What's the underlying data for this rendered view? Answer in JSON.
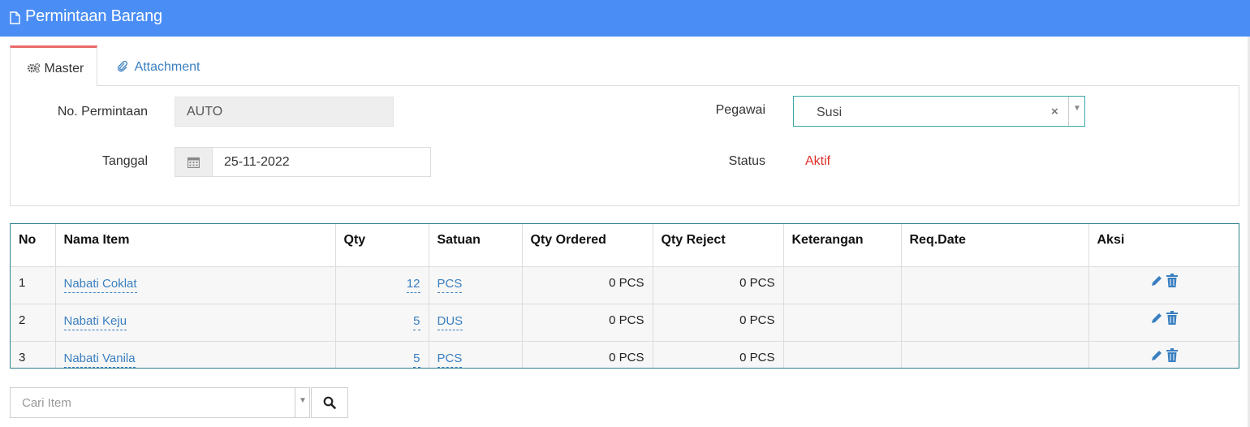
{
  "page": {
    "title": "Permintaan Barang"
  },
  "tabs": [
    {
      "label": "Master",
      "icon": "gears-icon",
      "active": true
    },
    {
      "label": "Attachment",
      "icon": "paperclip-icon",
      "active": false
    }
  ],
  "form": {
    "no_permintaan_label": "No. Permintaan",
    "no_permintaan_value": "AUTO",
    "tanggal_label": "Tanggal",
    "tanggal_value": "25-11-2022",
    "pegawai_label": "Pegawai",
    "pegawai_value": "Susi",
    "status_label": "Status",
    "status_value": "Aktif"
  },
  "table": {
    "columns": [
      "No",
      "Nama Item",
      "Qty",
      "Satuan",
      "Qty Ordered",
      "Qty Reject",
      "Keterangan",
      "Req.Date",
      "Aksi"
    ],
    "rows": [
      {
        "no": "1",
        "nama_item": "Nabati Coklat",
        "qty": "12",
        "satuan": "PCS",
        "qty_ordered": "0 PCS",
        "qty_reject": "0 PCS",
        "keterangan": "",
        "req_date": ""
      },
      {
        "no": "2",
        "nama_item": "Nabati Keju",
        "qty": "5",
        "satuan": "DUS",
        "qty_ordered": "0 PCS",
        "qty_reject": "0 PCS",
        "keterangan": "",
        "req_date": ""
      },
      {
        "no": "3",
        "nama_item": "Nabati Vanila",
        "qty": "5",
        "satuan": "PCS",
        "qty_ordered": "0 PCS",
        "qty_reject": "0 PCS",
        "keterangan": "",
        "req_date": ""
      }
    ]
  },
  "search": {
    "placeholder": "Cari Item"
  },
  "colors": {
    "header": "#4a8ef5",
    "link": "#3a7fc0",
    "status": "#e0302a",
    "tab_active": "#ea6a6a"
  }
}
